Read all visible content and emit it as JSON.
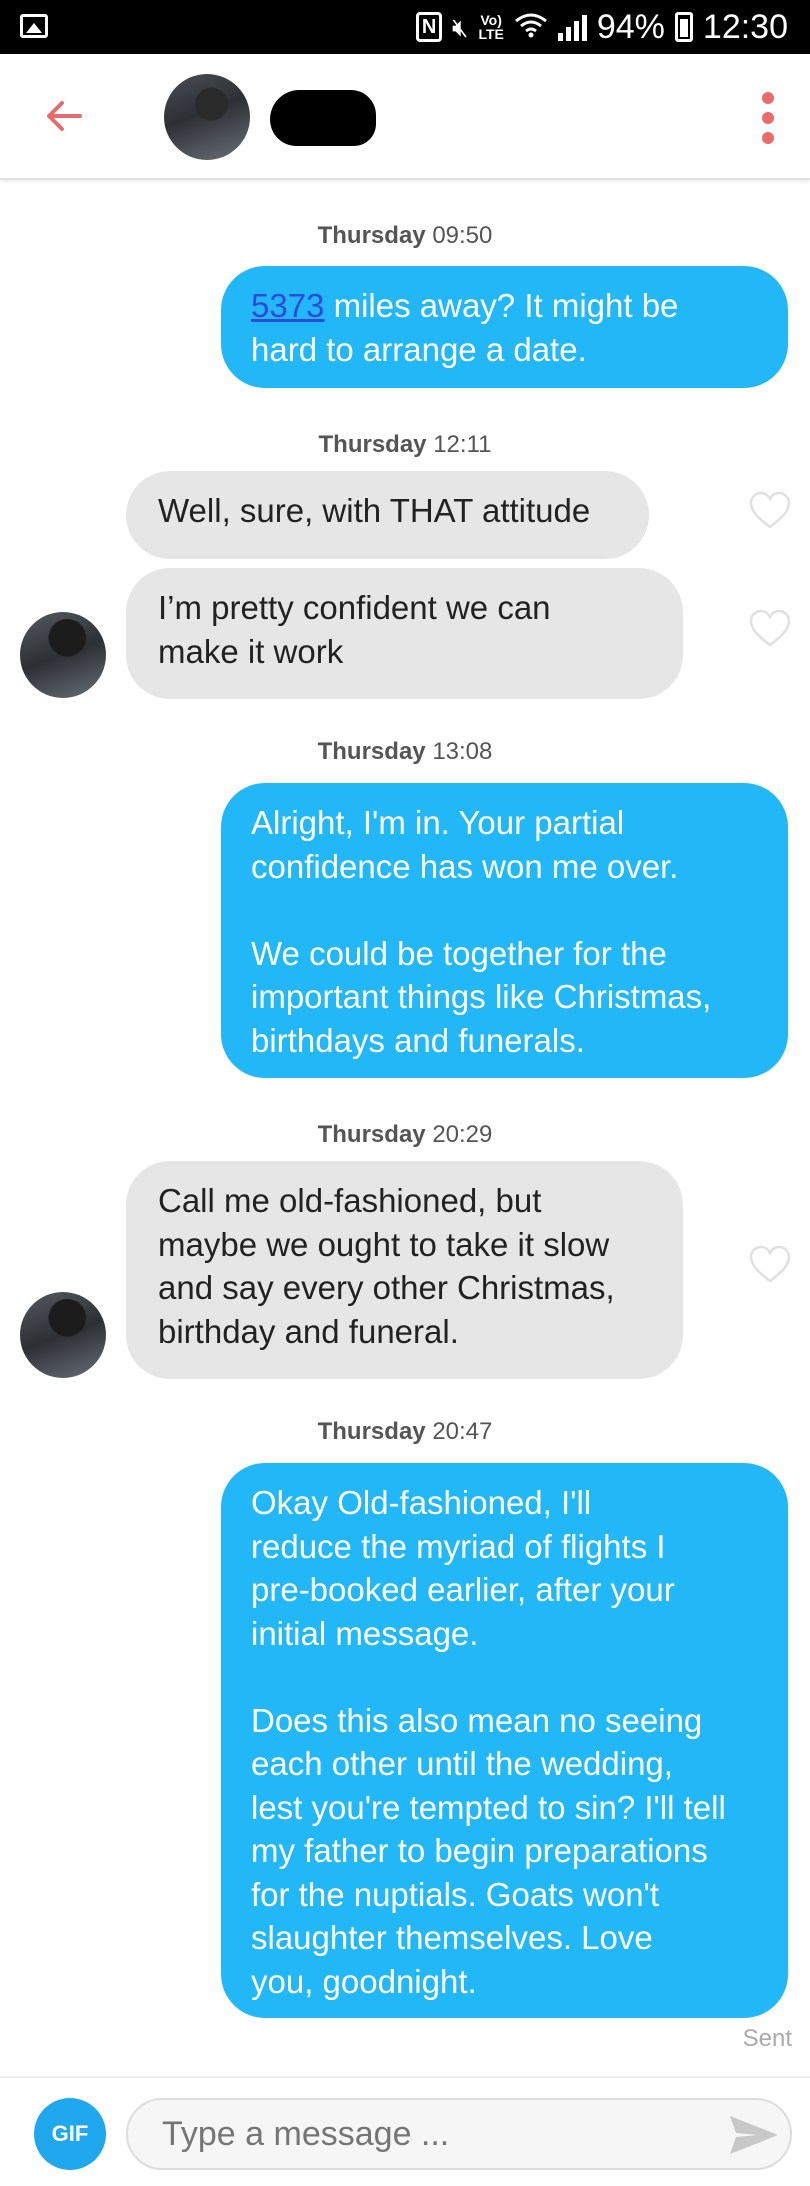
{
  "status_bar": {
    "battery": "94%",
    "time": "12:30",
    "volte": "Vo)\nLTE"
  },
  "header": {
    "back_icon": "arrow-left-icon",
    "menu_icon": "kebab-menu-icon",
    "accent_color": "#e96b6b"
  },
  "messages": [
    {
      "type": "timestamp",
      "day": "Thursday",
      "time": "09:50"
    },
    {
      "type": "outgoing",
      "link": "5373",
      "text": " miles away? It might be\nhard to arrange a date."
    },
    {
      "type": "timestamp",
      "day": "Thursday",
      "time": "12:11"
    },
    {
      "type": "incoming",
      "text": "Well, sure, with THAT attitude"
    },
    {
      "type": "incoming",
      "text": "I’m pretty confident we can\nmake it work"
    },
    {
      "type": "timestamp",
      "day": "Thursday",
      "time": "13:08"
    },
    {
      "type": "outgoing",
      "text": "Alright, I'm in. Your partial\nconfidence has won me over.\n\nWe could be together for the\nimportant things like Christmas,\nbirthdays and funerals."
    },
    {
      "type": "timestamp",
      "day": "Thursday",
      "time": "20:29"
    },
    {
      "type": "incoming",
      "text": "Call me old-fashioned, but\nmaybe we ought to take it slow\nand say every other Christmas,\nbirthday and funeral."
    },
    {
      "type": "timestamp",
      "day": "Thursday",
      "time": "20:47"
    },
    {
      "type": "outgoing",
      "text": "Okay Old-fashioned, I'll\nreduce the myriad of flights I\npre-booked earlier, after your\ninitial message.\n\nDoes this also mean no seeing\neach other until the wedding,\nlest you're tempted to sin? I'll tell\nmy father to begin preparations\nfor the nuptials. Goats won't\nslaughter themselves. Love\nyou, goodnight."
    }
  ],
  "sent_label": "Sent",
  "composer": {
    "gif_label": "GIF",
    "placeholder": "Type a message ...",
    "send_icon": "send-arrow-icon"
  },
  "colors": {
    "outgoing_bubble": "#22b8f7",
    "incoming_bubble": "#e6e6e6",
    "gif_button": "#1fa8ee"
  }
}
